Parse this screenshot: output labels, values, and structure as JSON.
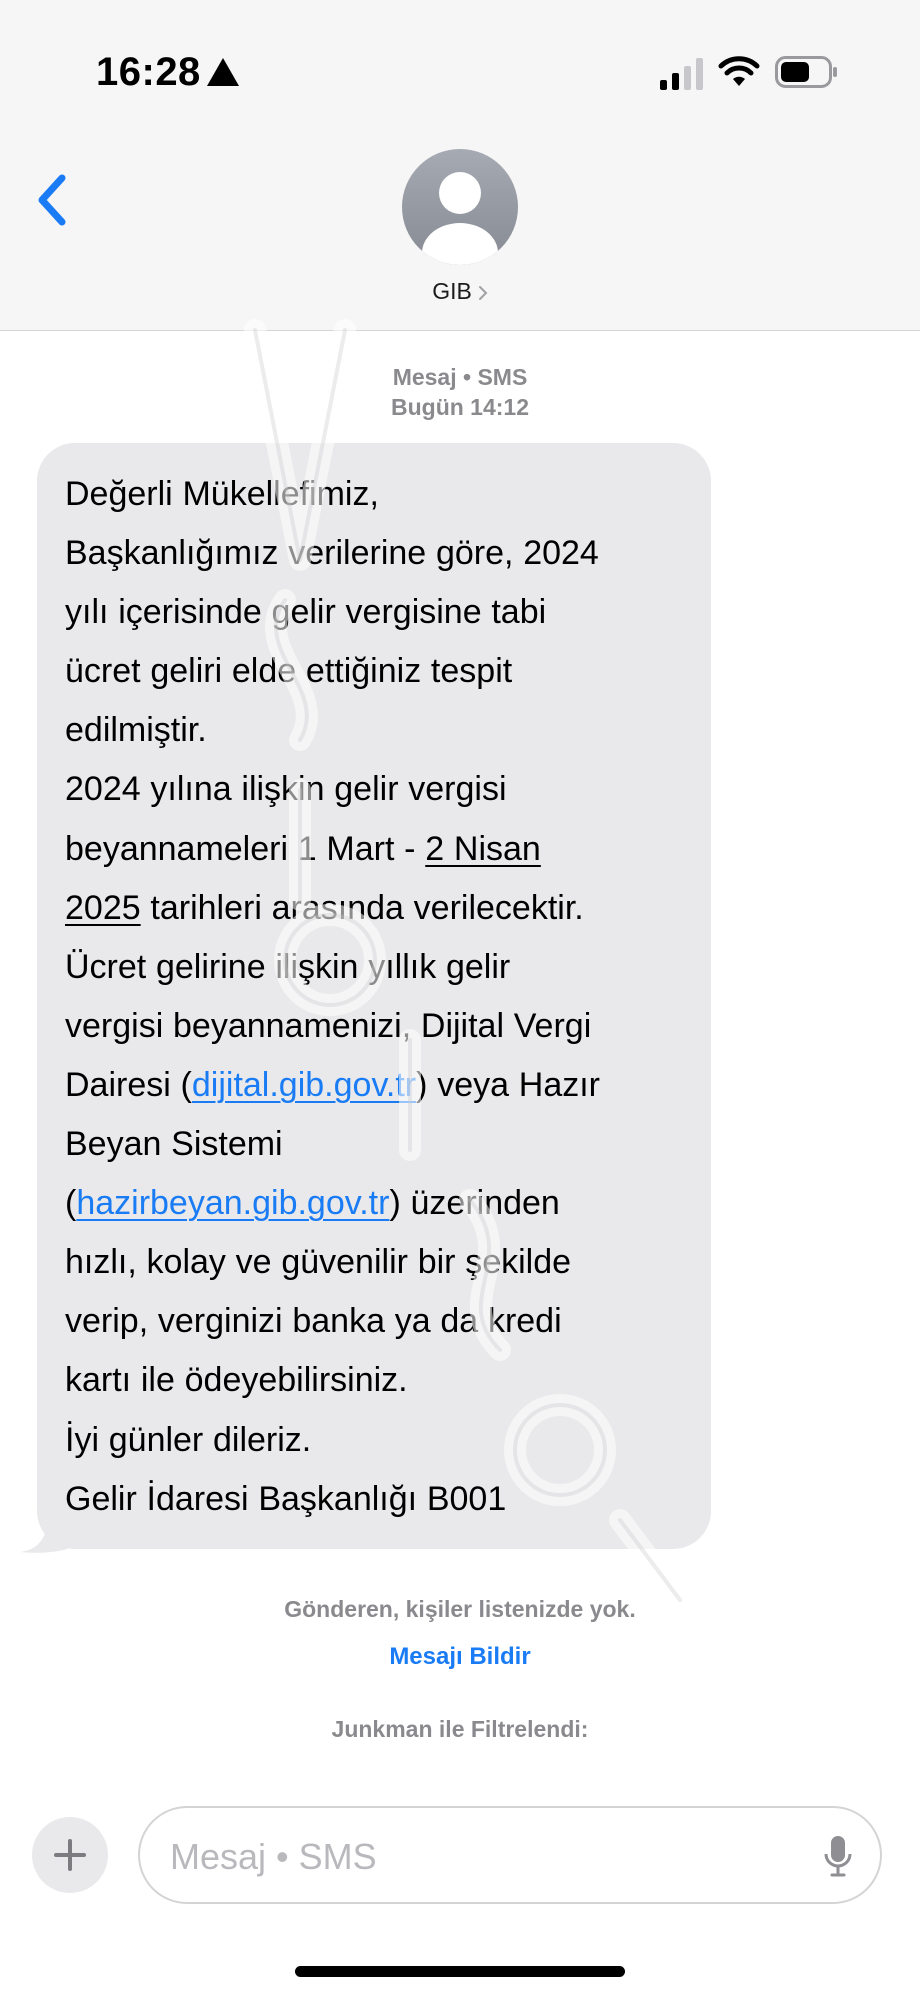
{
  "status_bar": {
    "time": "16:28",
    "alert_icon": "warning-triangle-icon",
    "signal_icon": "cellular-signal-icon",
    "wifi_icon": "wifi-icon",
    "battery_icon": "battery-icon"
  },
  "header": {
    "back_icon": "chevron-left-icon",
    "avatar_icon": "person-icon",
    "contact_name": "GIB",
    "contact_chevron_icon": "chevron-right-icon"
  },
  "thread": {
    "meta_line1": "Mesaj • SMS",
    "meta_line2": "Bugün 14:12",
    "message": {
      "l1": "Değerli Mükellefimiz,",
      "l2": "Başkanlığımız verilerine göre, 2024",
      "l3": "yılı içerisinde gelir vergisine tabi",
      "l4": "ücret geliri elde ettiğiniz tespit",
      "l5": "edilmiştir.",
      "l6": "2024 yılına ilişkin gelir vergisi",
      "l7_a": "beyannameleri 1 Mart - ",
      "l7_link": "2 Nisan",
      "l8_link": "2025",
      "l8_b": " tarihleri arasında verilecektir.",
      "l9": "Ücret gelirine ilişkin yıllık gelir",
      "l10": "vergisi beyannamenizi, Dijital Vergi",
      "l11_a": "Dairesi (",
      "l11_link": "dijital.gib.gov.tr",
      "l11_b": ") veya Hazır",
      "l12": "Beyan Sistemi",
      "l13_a": "(",
      "l13_link": "hazirbeyan.gib.gov.tr",
      "l13_b": ") üzerinden",
      "l14": "hızlı, kolay ve güvenilir bir şekilde",
      "l15": "verip, verginizi banka ya da kredi",
      "l16": "kartı ile ödeyebilirsiniz.",
      "l17": "İyi günler dileriz.",
      "l18": "Gelir İdaresi Başkanlığı B001"
    },
    "sender_note": "Gönderen, kişiler listenizde yok.",
    "report_link": "Mesajı Bildir",
    "filter_note": "Junkman ile Filtrelendi:"
  },
  "composer": {
    "plus_icon": "plus-icon",
    "placeholder": "Mesaj • SMS",
    "mic_icon": "microphone-icon"
  },
  "colors": {
    "accent": "#1a7cf5",
    "bubble": "#e9e9eb",
    "header_bg": "#f6f6f6",
    "secondary_text": "#8a8a8e"
  }
}
